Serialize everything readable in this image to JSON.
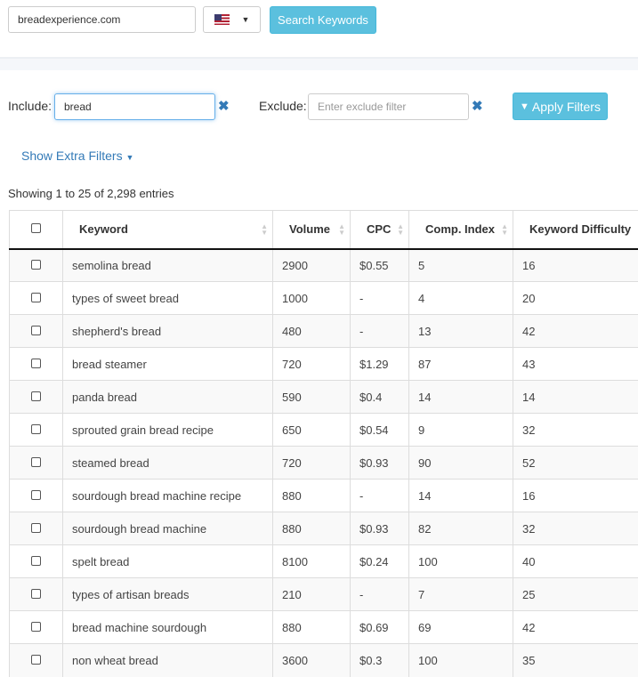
{
  "search": {
    "domain": "breadexperience.com",
    "country_flag": "us-flag-icon",
    "button": "Search Keywords"
  },
  "filters": {
    "include_label": "Include:",
    "include_value": "bread",
    "exclude_label": "Exclude:",
    "exclude_placeholder": "Enter exclude filter",
    "apply": "Apply Filters",
    "extra": "Show Extra Filters"
  },
  "info": "Showing 1 to 25 of 2,298 entries",
  "columns": [
    "Keyword",
    "Volume",
    "CPC",
    "Comp. Index",
    "Keyword Difficulty"
  ],
  "rows": [
    [
      "semolina bread",
      "2900",
      "$0.55",
      "5",
      "16"
    ],
    [
      "types of sweet bread",
      "1000",
      "-",
      "4",
      "20"
    ],
    [
      "shepherd's bread",
      "480",
      "-",
      "13",
      "42"
    ],
    [
      "bread steamer",
      "720",
      "$1.29",
      "87",
      "43"
    ],
    [
      "panda bread",
      "590",
      "$0.4",
      "14",
      "14"
    ],
    [
      "sprouted grain bread recipe",
      "650",
      "$0.54",
      "9",
      "32"
    ],
    [
      "steamed bread",
      "720",
      "$0.93",
      "90",
      "52"
    ],
    [
      "sourdough bread machine recipe",
      "880",
      "-",
      "14",
      "16"
    ],
    [
      "sourdough bread machine",
      "880",
      "$0.93",
      "82",
      "32"
    ],
    [
      "spelt bread",
      "8100",
      "$0.24",
      "100",
      "40"
    ],
    [
      "types of artisan breads",
      "210",
      "-",
      "7",
      "25"
    ],
    [
      "bread machine sourdough",
      "880",
      "$0.69",
      "69",
      "42"
    ],
    [
      "non wheat bread",
      "3600",
      "$0.3",
      "100",
      "35"
    ]
  ]
}
